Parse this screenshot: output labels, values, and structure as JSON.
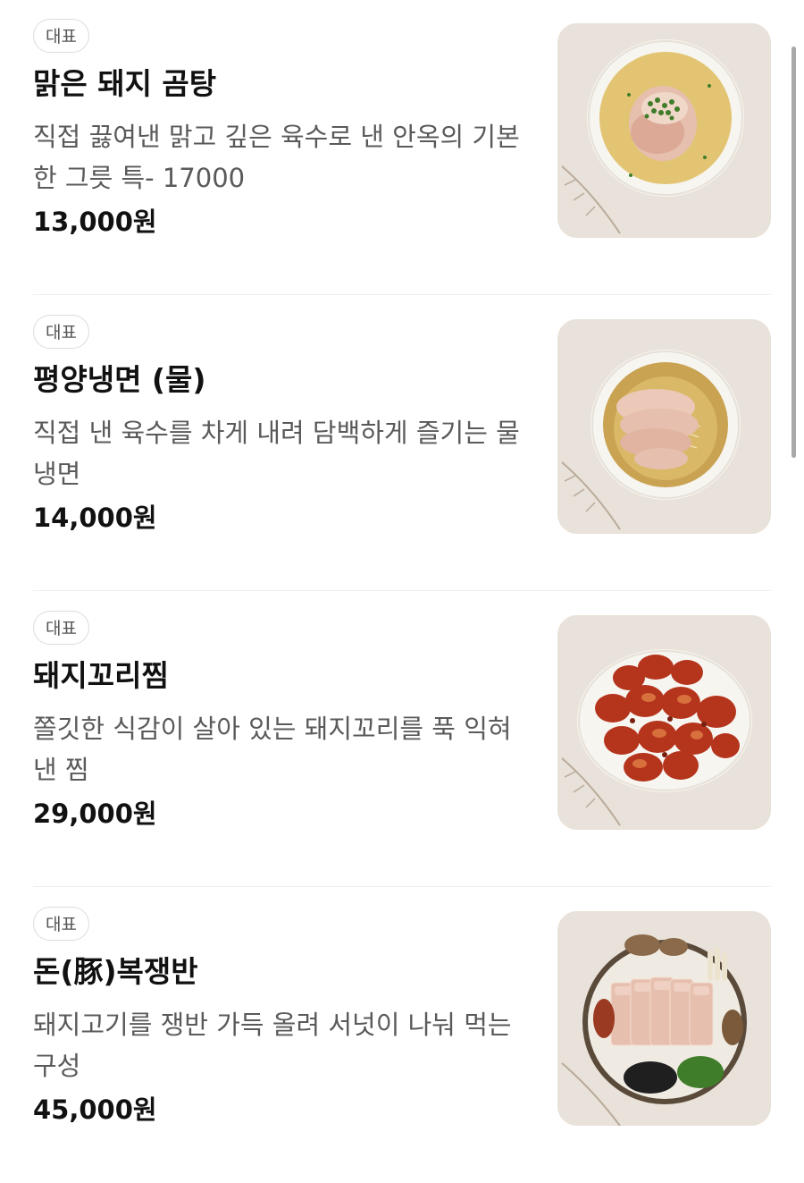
{
  "menu": {
    "items": [
      {
        "badge": "대표",
        "name": "맑은 돼지 곰탕",
        "description": "직접 끓여낸 맑고 깊은 육수로 낸 안옥의 기본 한 그릇 특- 17000",
        "price": "13,000원",
        "image_icon": "clear-pork-soup-photo"
      },
      {
        "badge": "대표",
        "name": "평양냉면 (물)",
        "description": "직접 낸 육수를 차게 내려 담백하게 즐기는 물냉면",
        "price": "14,000원",
        "image_icon": "cold-noodle-photo"
      },
      {
        "badge": "대표",
        "name": "돼지꼬리찜",
        "description": "쫄깃한 식감이 살아 있는 돼지꼬리를 푹 익혀 낸 찜",
        "price": "29,000원",
        "image_icon": "braised-pork-tail-photo"
      },
      {
        "badge": "대표",
        "name": "돈(豚)복쟁반",
        "description": "돼지고기를 쟁반 가득 올려 서넛이 나눠 먹는 구성",
        "price": "45,000원",
        "image_icon": "pork-platter-photo"
      }
    ]
  },
  "colors": {
    "photo_background": "#e9e2da",
    "bowl": "#f7f5f0",
    "broth": "#e3c472",
    "pork": "#e6bfae",
    "sauce_red": "#b5341c",
    "scallion": "#3f7d2a"
  }
}
